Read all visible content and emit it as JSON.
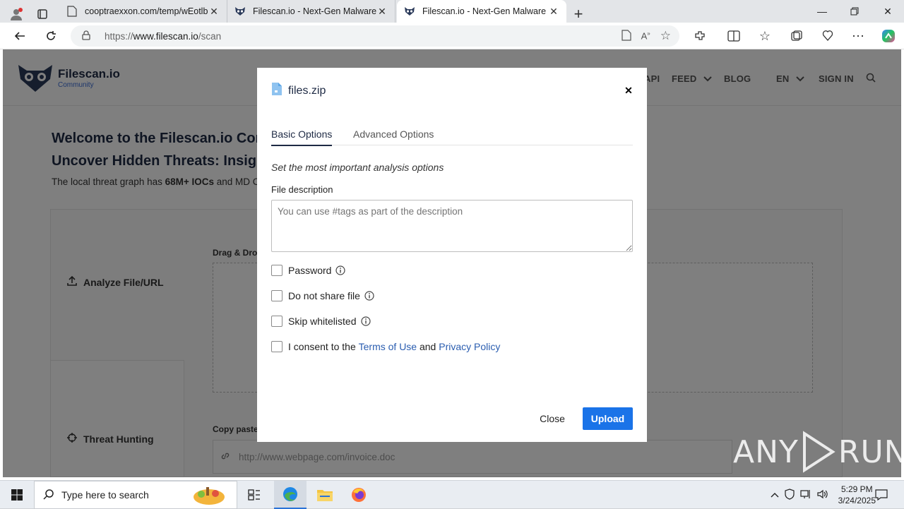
{
  "browser": {
    "tabs": [
      {
        "title": "cooptraexxon.com/temp/wEotlb",
        "active": false
      },
      {
        "title": "Filescan.io - Next-Gen Malware A",
        "active": false
      },
      {
        "title": "Filescan.io - Next-Gen Malware A",
        "active": true
      }
    ],
    "url_prefix": "https://",
    "url_host": "www.filescan.io",
    "url_path": "/scan"
  },
  "site": {
    "brand_name": "Filescan.io",
    "brand_sub": "Community",
    "nav": {
      "api": "API",
      "feed": "FEED",
      "blog": "BLOG",
      "lang": "EN",
      "signin": "SIGN IN"
    },
    "hero_title_1": "Welcome to the Filescan.io Comm",
    "hero_title_2_pre": "Uncover ",
    "hero_title_2_strong": "Hidden Threats: Insightf",
    "hero_sub_pre": "The local threat graph has ",
    "hero_sub_strong": "68M+ IOCs",
    "hero_sub_post": " and MD C",
    "sidebar": {
      "analyze": "Analyze File/URL",
      "hunting": "Threat Hunting"
    },
    "drag_label": "Drag & Dro",
    "copy_label": "Copy paste",
    "url_placeholder": "http://www.webpage.com/invoice.doc"
  },
  "modal": {
    "file_name": "files.zip",
    "tabs": [
      "Basic Options",
      "Advanced Options"
    ],
    "active_tab": "Basic Options",
    "hint": "Set the most important analysis options",
    "description_label": "File description",
    "description_placeholder": "You can use #tags as part of the description",
    "options": {
      "password": "Password",
      "no_share": "Do not share file",
      "skip_whitelisted": "Skip whitelisted",
      "consent_pre": "I consent to the ",
      "consent_terms": "Terms of Use",
      "consent_and": " and ",
      "consent_privacy": "Privacy Policy"
    },
    "close_label": "Close",
    "upload_label": "Upload"
  },
  "watermark": {
    "left": "ANY",
    "right": "RUN"
  },
  "taskbar": {
    "search_placeholder": "Type here to search",
    "time": "5:29 PM",
    "date": "3/24/2025"
  },
  "colors": {
    "accent": "#1a73e8",
    "link": "#2a5db0",
    "brand_dark": "#1e2a44"
  }
}
